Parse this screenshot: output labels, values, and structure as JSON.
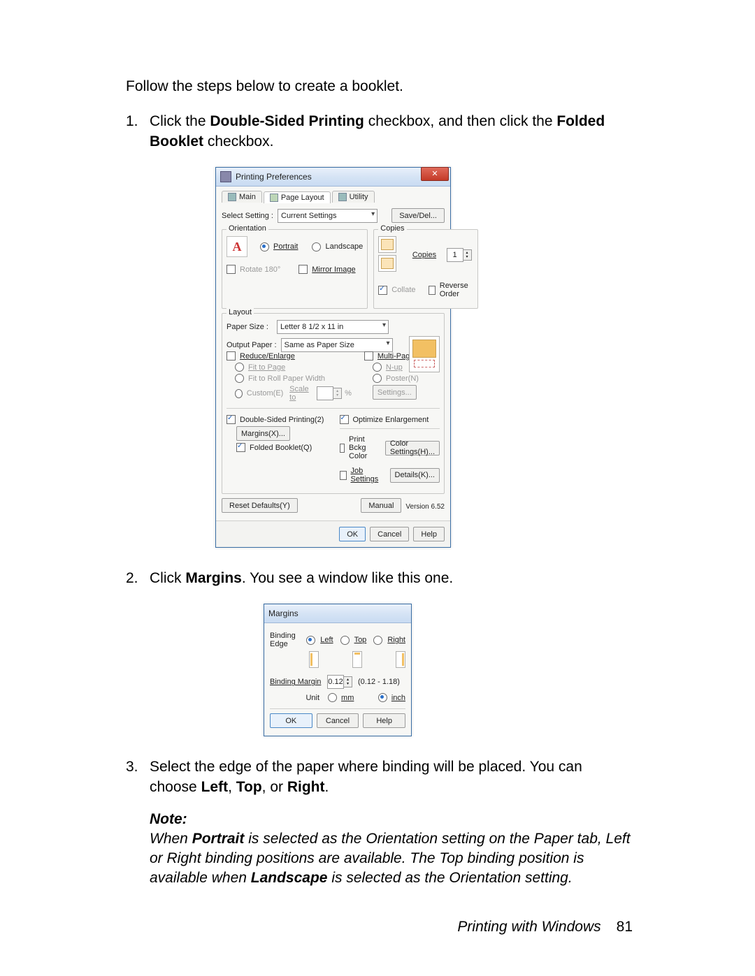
{
  "intro": "Follow the steps below to create a booklet.",
  "step1": {
    "num": "1.",
    "pre": "Click the ",
    "b1": "Double-Sided Printing",
    "mid": " checkbox, and then click the ",
    "b2": "Folded Booklet",
    "post": " checkbox."
  },
  "step2": {
    "num": "2.",
    "pre": "Click ",
    "b1": "Margins",
    "post": ". You see a window like this one."
  },
  "step3": {
    "num": "3.",
    "pre": "Select the edge of the paper where binding will be placed. You can choose ",
    "b1": "Left",
    "c1": ", ",
    "b2": "Top",
    "c2": ", or ",
    "b3": "Right",
    "post": "."
  },
  "note": {
    "head": "Note:",
    "seg1": "When ",
    "b1": "Portrait",
    "seg2": " is selected as the Orientation setting on the Paper tab, Left or Right binding positions are available. The Top binding position is available when ",
    "b2": "Landscape",
    "seg3": " is selected as the Orientation setting."
  },
  "dlg1": {
    "title": "Printing Preferences",
    "tabs": {
      "main": "Main",
      "layout": "Page Layout",
      "utility": "Utility"
    },
    "selectSetting": {
      "label": "Select Setting :",
      "value": "Current Settings",
      "btn": "Save/Del..."
    },
    "orientation": {
      "frame": "Orientation",
      "portrait": "Portrait",
      "landscape": "Landscape",
      "rotate": "Rotate 180°",
      "mirror": "Mirror Image"
    },
    "copies": {
      "frame": "Copies",
      "label": "Copies",
      "value": "1",
      "collate": "Collate",
      "reverse": "Reverse Order"
    },
    "layout": {
      "frame": "Layout",
      "paperSize": {
        "label": "Paper Size :",
        "value": "Letter 8 1/2 x 11 in"
      },
      "outputPaper": {
        "label": "Output Paper :",
        "value": "Same as Paper Size"
      },
      "reduce": "Reduce/Enlarge",
      "fitPage": "Fit to Page",
      "fitRoll": "Fit to Roll Paper Width",
      "custom": "Custom(E)",
      "scaleTo": "Scale to",
      "pct": "%",
      "multiPage": "Multi-Page",
      "nup": "N-up",
      "poster": "Poster(N)",
      "settings": "Settings...",
      "dsp": "Double-Sided Printing(2)",
      "margins": "Margins(X)...",
      "folded": "Folded Booklet(Q)",
      "optEnlarge": "Optimize Enlargement",
      "bkg": "Print Bckg Color",
      "colorSettings": "Color Settings(H)...",
      "job": "Job Settings",
      "details": "Details(K)..."
    },
    "bottom": {
      "reset": "Reset Defaults(Y)",
      "manual": "Manual",
      "version": "Version 6.52"
    },
    "footer": {
      "ok": "OK",
      "cancel": "Cancel",
      "help": "Help"
    }
  },
  "dlg2": {
    "title": "Margins",
    "bindingEdge": {
      "label": "Binding Edge",
      "left": "Left",
      "top": "Top",
      "right": "Right"
    },
    "bindingMargin": {
      "label": "Binding Margin",
      "value": "0.12",
      "range": "(0.12 - 1.18)"
    },
    "unit": {
      "label": "Unit",
      "mm": "mm",
      "inch": "inch"
    },
    "footer": {
      "ok": "OK",
      "cancel": "Cancel",
      "help": "Help"
    }
  },
  "pageFooter": {
    "section": "Printing with Windows",
    "page": "81"
  }
}
